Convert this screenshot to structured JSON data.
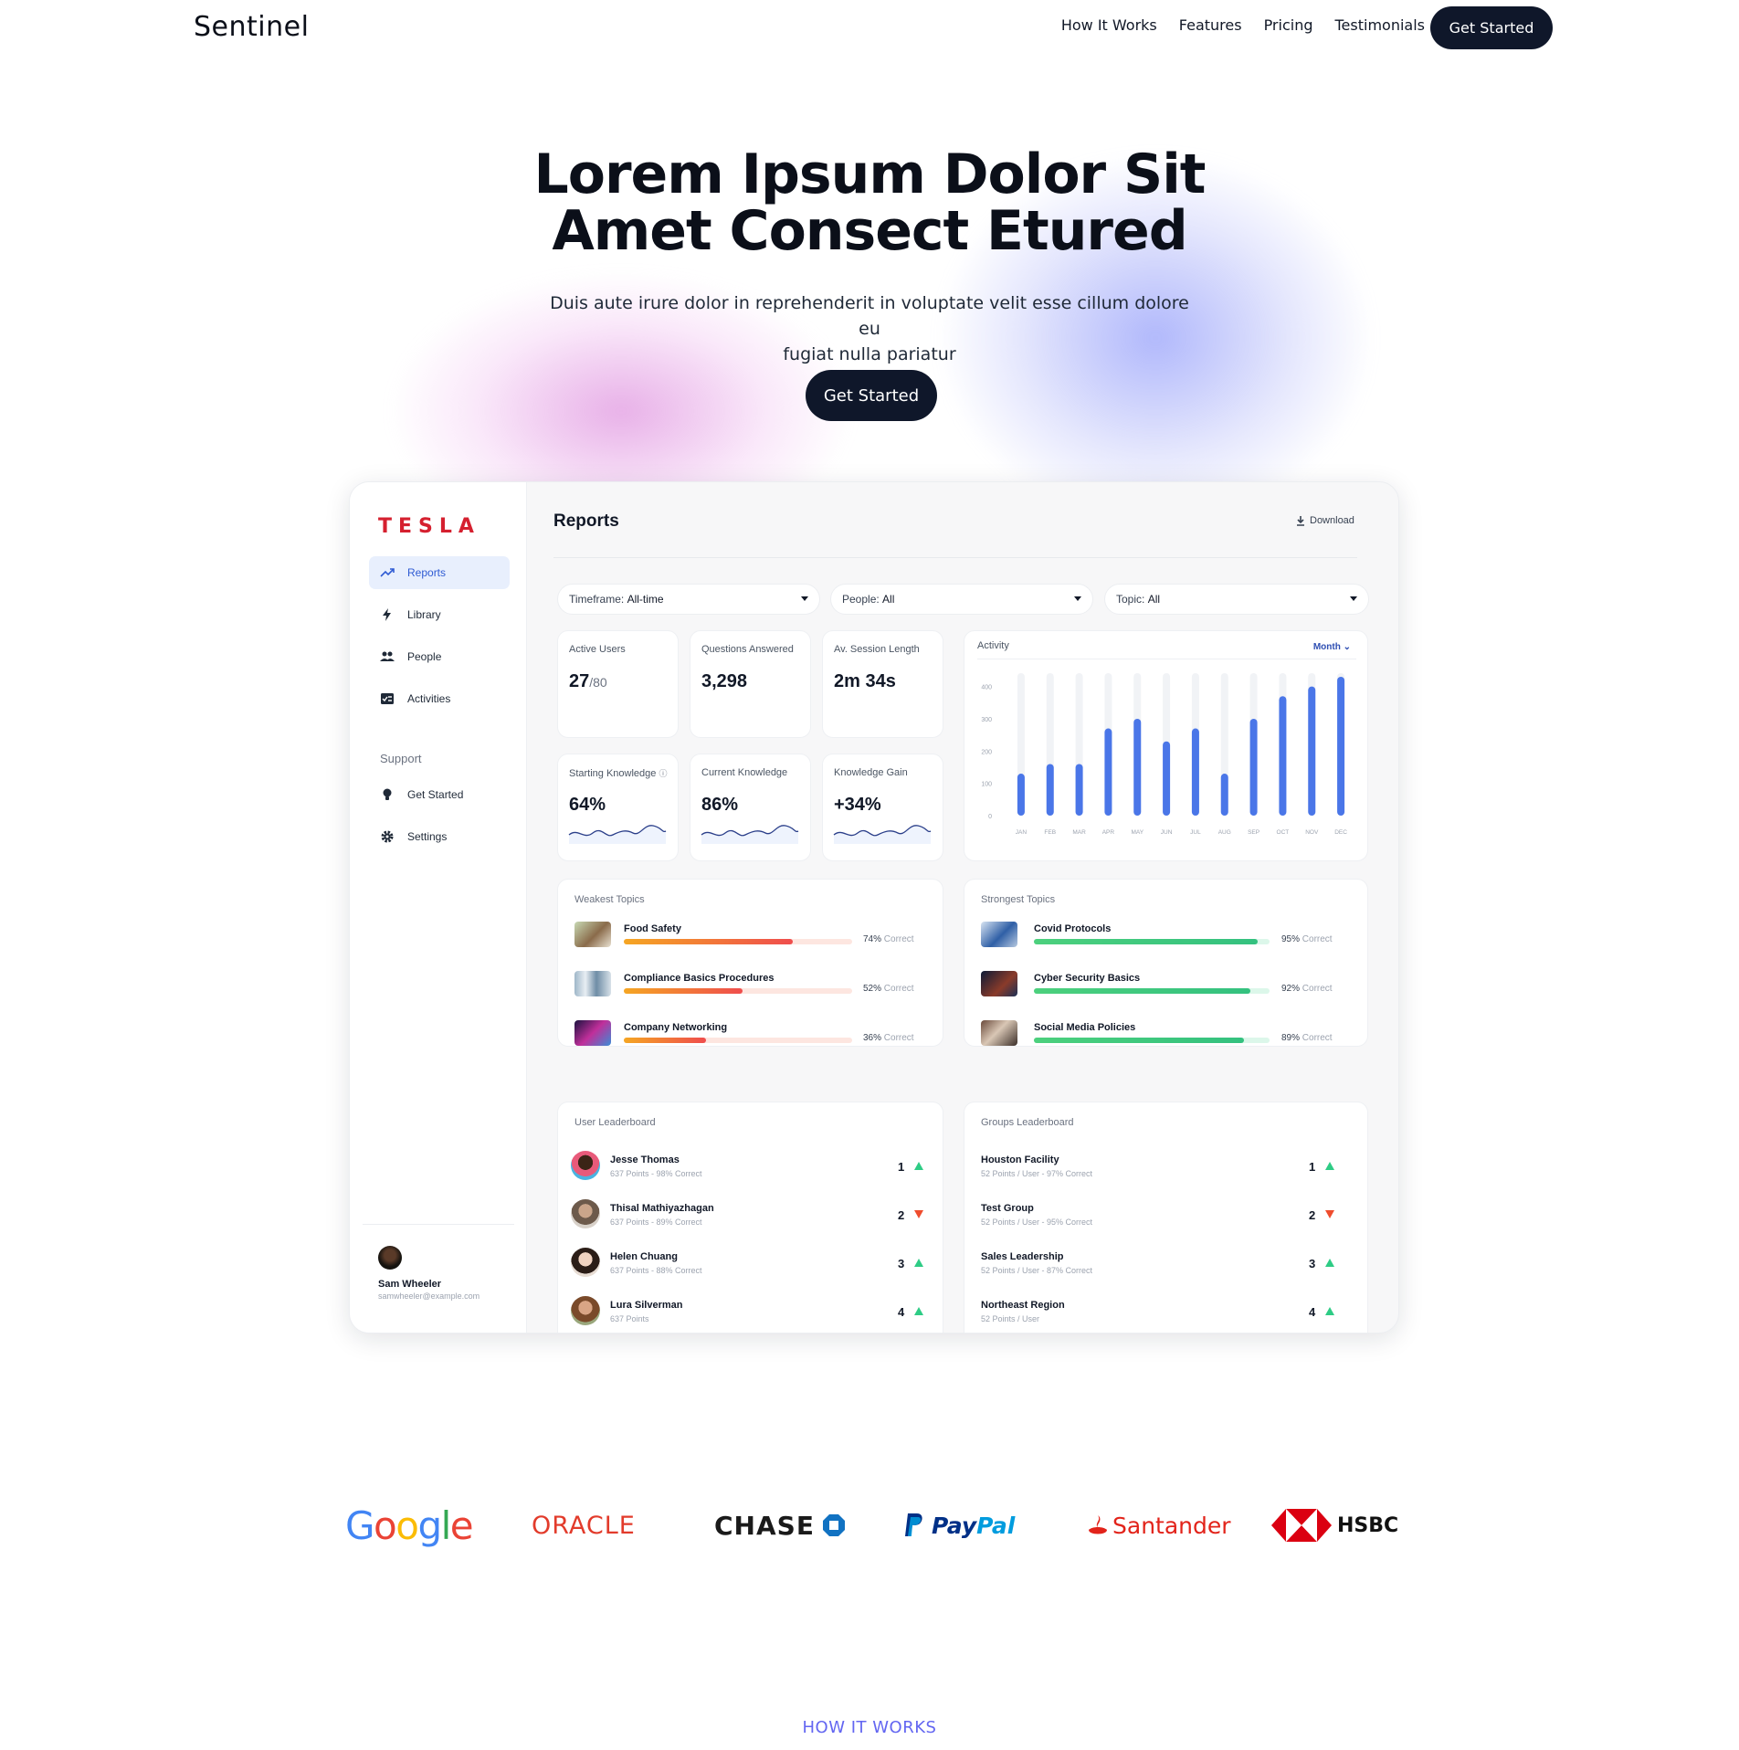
{
  "nav": {
    "logo": "Sentinel",
    "links": [
      "How It Works",
      "Features",
      "Pricing",
      "Testimonials"
    ],
    "cta": "Get Started"
  },
  "hero": {
    "title_line1": "Lorem Ipsum Dolor Sit",
    "title_line2": "Amet Consect Etured",
    "subtitle_line1": "Duis aute irure dolor in reprehenderit in voluptate velit esse cillum dolore eu",
    "subtitle_line2": "fugiat nulla pariatur",
    "cta": "Get Started"
  },
  "dashboard": {
    "brand": "TESLA",
    "brand_color": "#d5202f",
    "sidebar": {
      "items": [
        {
          "label": "Reports",
          "icon": "trending-up-icon",
          "active": true
        },
        {
          "label": "Library",
          "icon": "bolt-icon",
          "active": false
        },
        {
          "label": "People",
          "icon": "people-icon",
          "active": false
        },
        {
          "label": "Activities",
          "icon": "checklist-icon",
          "active": false
        }
      ],
      "support_label": "Support",
      "support_items": [
        {
          "label": "Get Started",
          "icon": "lightbulb-icon"
        },
        {
          "label": "Settings",
          "icon": "gear-icon"
        }
      ],
      "user": {
        "name": "Sam Wheeler",
        "email": "samwheeler@example.com"
      }
    },
    "title": "Reports",
    "download_label": "Download",
    "filters": [
      {
        "label": "Timeframe:",
        "value": "All-time"
      },
      {
        "label": "People:",
        "value": "All"
      },
      {
        "label": "Topic:",
        "value": "All"
      }
    ],
    "stats": [
      {
        "label": "Active Users",
        "value": "27",
        "suffix": "/80"
      },
      {
        "label": "Questions Answered",
        "value": "3,298",
        "suffix": ""
      },
      {
        "label": "Av. Session Length",
        "value": "2m 34s",
        "suffix": ""
      },
      {
        "label": "Starting Knowledge",
        "value": "64%",
        "suffix": ""
      },
      {
        "label": "Current Knowledge",
        "value": "86%",
        "suffix": ""
      },
      {
        "label": "Knowledge Gain",
        "value": "+34%",
        "suffix": ""
      }
    ],
    "activity": {
      "title": "Activity",
      "range": "Month",
      "accent": "#4a76e8"
    },
    "weakest": {
      "title": "Weakest Topics",
      "items": [
        {
          "name": "Food Safety",
          "pct": "74%",
          "tail": "Correct",
          "value": 74
        },
        {
          "name": "Compliance Basics Procedures",
          "pct": "52%",
          "tail": "Correct",
          "value": 52
        },
        {
          "name": "Company Networking",
          "pct": "36%",
          "tail": "Correct",
          "value": 36
        }
      ]
    },
    "strongest": {
      "title": "Strongest Topics",
      "items": [
        {
          "name": "Covid Protocols",
          "pct": "95%",
          "tail": "Correct",
          "value": 95
        },
        {
          "name": "Cyber Security Basics",
          "pct": "92%",
          "tail": "Correct",
          "value": 92
        },
        {
          "name": "Social Media Policies",
          "pct": "89%",
          "tail": "Correct",
          "value": 89
        }
      ]
    },
    "user_leaderboard": {
      "title": "User Leaderboard",
      "rows": [
        {
          "name": "Jesse Thomas",
          "sub": "637 Points - 98% Correct",
          "rank": "1",
          "trend": "up"
        },
        {
          "name": "Thisal Mathiyazhagan",
          "sub": "637 Points - 89% Correct",
          "rank": "2",
          "trend": "down"
        },
        {
          "name": "Helen Chuang",
          "sub": "637 Points - 88% Correct",
          "rank": "3",
          "trend": "up"
        },
        {
          "name": "Lura Silverman",
          "sub": "637 Points",
          "rank": "4",
          "trend": "up"
        }
      ]
    },
    "groups_leaderboard": {
      "title": "Groups Leaderboard",
      "rows": [
        {
          "name": "Houston Facility",
          "sub": "52 Points / User - 97% Correct",
          "rank": "1",
          "trend": "up"
        },
        {
          "name": "Test Group",
          "sub": "52 Points / User - 95% Correct",
          "rank": "2",
          "trend": "down"
        },
        {
          "name": "Sales Leadership",
          "sub": "52 Points / User - 87% Correct",
          "rank": "3",
          "trend": "up"
        },
        {
          "name": "Northeast Region",
          "sub": "52 Points / User",
          "rank": "4",
          "trend": "up"
        }
      ]
    }
  },
  "chart_data": {
    "type": "bar",
    "title": "Activity",
    "categories": [
      "JAN",
      "FEB",
      "MAR",
      "APR",
      "MAY",
      "JUN",
      "JUL",
      "AUG",
      "SEP",
      "OCT",
      "NOV",
      "DEC"
    ],
    "values": [
      130,
      160,
      160,
      270,
      300,
      230,
      270,
      130,
      300,
      370,
      400,
      430
    ],
    "yticks": [
      "0",
      "100",
      "200",
      "300",
      "400"
    ],
    "ylim": [
      0,
      430
    ],
    "grid": false
  },
  "logos": [
    "Google",
    "ORACLE",
    "CHASE",
    "PayPal",
    "Santander",
    "HSBC"
  ],
  "section_label": "HOW IT WORKS"
}
